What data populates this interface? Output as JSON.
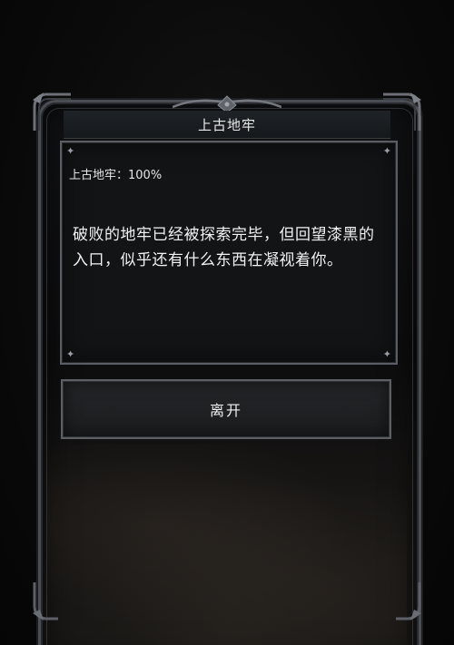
{
  "dialog": {
    "title": "上古地牢",
    "progress": "上古地牢：100%",
    "description": "破败的地牢已经被探索完毕，但回望漆黑的入口，似乎还有什么东西在凝视着你。",
    "leave_label": "离开"
  },
  "colors": {
    "background": "#0b0b0b",
    "frame_border": "#4a4d52",
    "panel_border": "#5a5d63",
    "text": "#f2f2f2"
  }
}
